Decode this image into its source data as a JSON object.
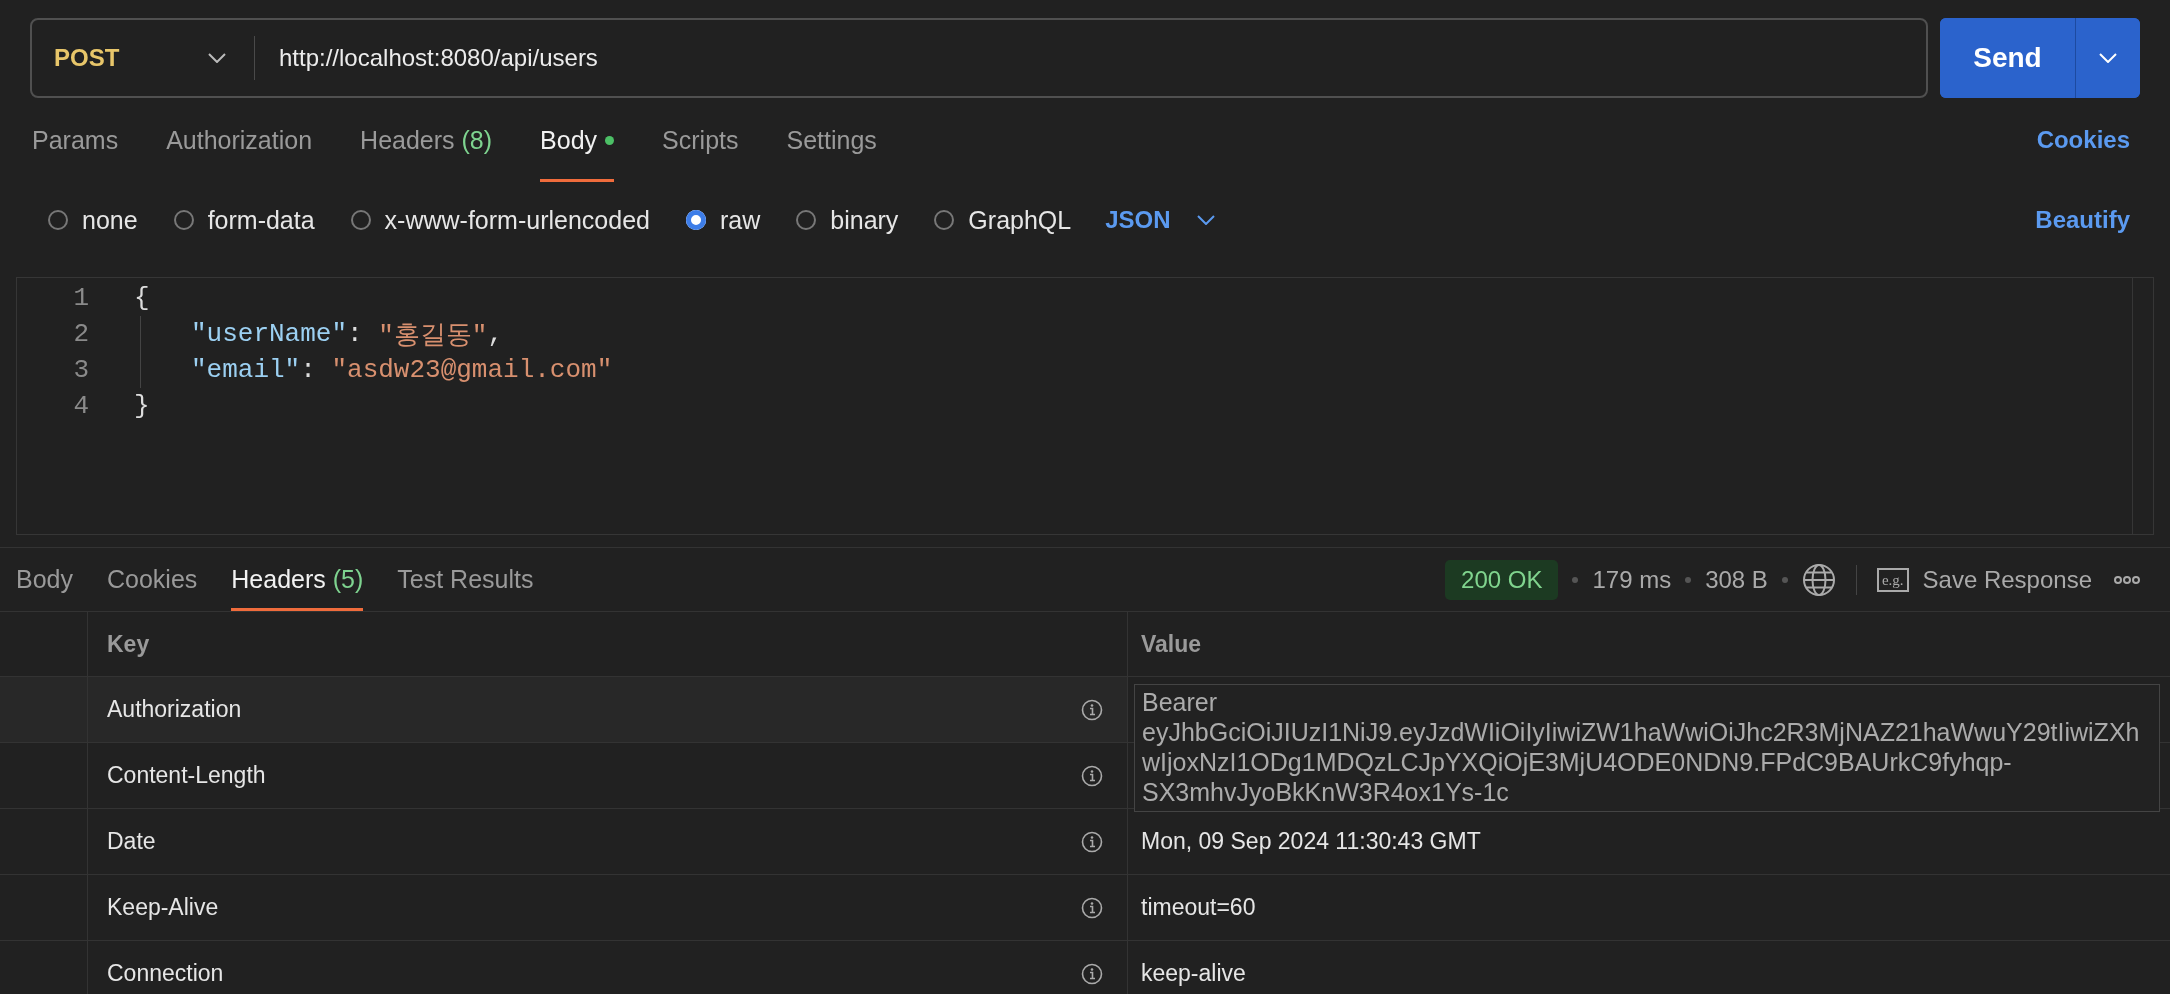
{
  "request": {
    "method": "POST",
    "url": "http://localhost:8080/api/users",
    "send": "Send"
  },
  "request_tabs": [
    {
      "label": "Params",
      "selected": false
    },
    {
      "label": "Authorization",
      "selected": false
    },
    {
      "label": "Headers",
      "count": "(8)",
      "selected": false
    },
    {
      "label": "Body",
      "dot": true,
      "selected": true
    },
    {
      "label": "Scripts",
      "selected": false
    },
    {
      "label": "Settings",
      "selected": false
    }
  ],
  "cookies_link": "Cookies",
  "body_types": [
    {
      "label": "none",
      "selected": false
    },
    {
      "label": "form-data",
      "selected": false
    },
    {
      "label": "x-www-form-urlencoded",
      "selected": false
    },
    {
      "label": "raw",
      "selected": true
    },
    {
      "label": "binary",
      "selected": false
    },
    {
      "label": "GraphQL",
      "selected": false
    }
  ],
  "language": "JSON",
  "beautify": "Beautify",
  "editor": {
    "lines": [
      {
        "number": "1",
        "indented": false,
        "tokens": [
          {
            "kind": "punct",
            "text": "{"
          }
        ]
      },
      {
        "number": "2",
        "indented": true,
        "tokens": [
          {
            "kind": "key",
            "text": "\"userName\""
          },
          {
            "kind": "punct",
            "text": ": "
          },
          {
            "kind": "string",
            "text": "\"홍길동\""
          },
          {
            "kind": "punct",
            "text": ","
          }
        ]
      },
      {
        "number": "3",
        "indented": true,
        "tokens": [
          {
            "kind": "key",
            "text": "\"email\""
          },
          {
            "kind": "punct",
            "text": ": "
          },
          {
            "kind": "string",
            "text": "\"asdw23@gmail.com\""
          }
        ]
      },
      {
        "number": "4",
        "indented": false,
        "tokens": [
          {
            "kind": "punct",
            "text": "}"
          }
        ]
      }
    ]
  },
  "response_tabs": [
    {
      "label": "Body",
      "selected": false
    },
    {
      "label": "Cookies",
      "selected": false
    },
    {
      "label": "Headers",
      "count": "(5)",
      "selected": true
    },
    {
      "label": "Test Results",
      "selected": false
    }
  ],
  "response_status": {
    "code": "200 OK",
    "time": "179 ms",
    "size": "308 B",
    "save_icon": "e.g.",
    "save": "Save Response"
  },
  "headers_table": {
    "columns": [
      "Key",
      "Value"
    ],
    "rows": [
      {
        "key": "Authorization",
        "value": "Bearer eyJhbGciOiJIUzI1NiJ9.eyJzdWIiOiIyIiwiZW1haWwiOiJhc2R3MjNAZ21haWwuY29tIiwiZXhwIjoxNzI1ODg1MDQzLCJpYXQiOjE3MjU4ODE0NDN9.FPdC9BAUrkC9fyhqp-SX3mhvJyoBkKnW3R4ox1Ys-1c",
        "expanded": true
      },
      {
        "key": "Content-Length",
        "expanded": false
      },
      {
        "key": "Date",
        "value": "Mon, 09 Sep 2024 11:30:43 GMT",
        "expanded": false
      },
      {
        "key": "Keep-Alive",
        "value": "timeout=60",
        "expanded": false
      },
      {
        "key": "Connection",
        "value": "keep-alive",
        "expanded": false
      }
    ]
  }
}
